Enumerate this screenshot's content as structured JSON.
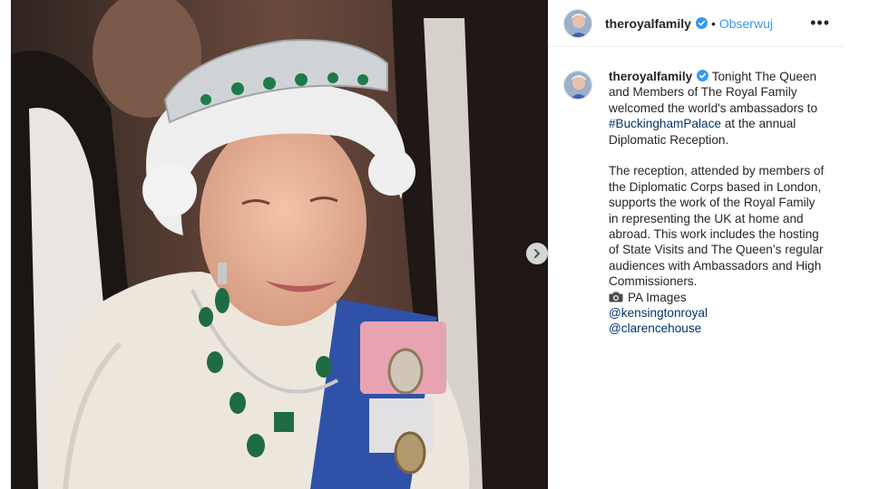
{
  "post": {
    "username": "theroyalfamily",
    "follow_label": "Obserwuj",
    "separator": "•",
    "more_label": "•••"
  },
  "caption": {
    "username": "theroyalfamily",
    "para1_start": " Tonight The Queen and Members of The Royal Family welcomed the world's ambassadors to ",
    "hashtag": "#BuckinghamPalace",
    "para1_end": " at the annual Diplomatic Reception.",
    "para2": "The reception, attended by members of the Diplomatic Corps based in London, supports the work of the Royal Family in representing the UK at home and abroad. This work includes the hosting of State Visits and The Queen’s regular audiences with Ambassadors and High Commissioners.",
    "photo_credit": "PA Images",
    "mention1": "@kensingtonroyal",
    "mention2": "@clarencehouse"
  },
  "icons": {
    "verified": "verified-badge-icon",
    "camera": "camera-icon",
    "next": "chevron-right-icon",
    "more": "more-options-icon"
  },
  "colors": {
    "link": "#003569",
    "follow": "#3897f0",
    "verified": "#3897f0"
  }
}
